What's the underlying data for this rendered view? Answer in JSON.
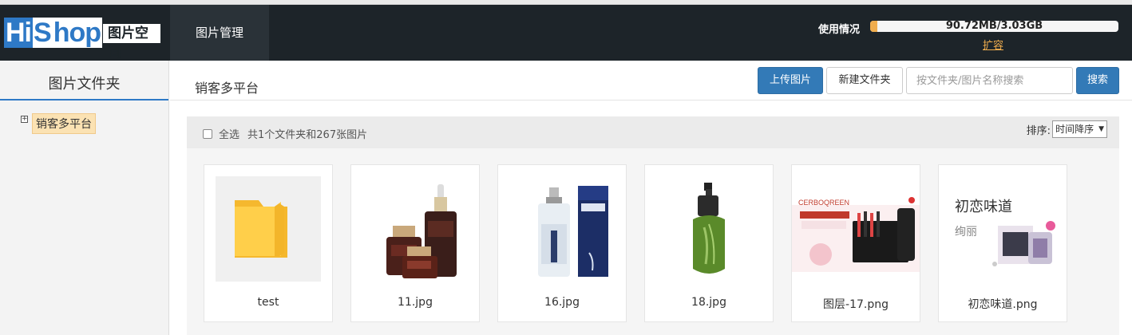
{
  "header": {
    "logo": {
      "brand_part1": "Hi",
      "brand_part2": "S",
      "brand_part3": "hop",
      "subtitle": "图片空间"
    },
    "nav_tab": "图片管理",
    "usage_label": "使用情况",
    "usage_text": "90.72MB/3.03GB",
    "usage_fraction": 0.029,
    "expand_link": "扩容"
  },
  "sidebar": {
    "title": "图片文件夹",
    "tree": [
      {
        "toggle": "+",
        "label": "销客多平台"
      }
    ]
  },
  "main": {
    "title": "销客多平台",
    "upload_label": "上传图片",
    "new_folder_label": "新建文件夹",
    "search_placeholder": "按文件夹/图片名称搜索",
    "search_value": "",
    "search_label": "搜索"
  },
  "toolbar": {
    "select_all_label": "全选",
    "summary": "共1个文件夹和267张图片",
    "sort_label": "排序:",
    "sort_value": "时间降序"
  },
  "items": [
    {
      "name": "test",
      "type": "folder",
      "icon": "folder-icon"
    },
    {
      "name": "11.jpg",
      "type": "image"
    },
    {
      "name": "16.jpg",
      "type": "image"
    },
    {
      "name": "18.jpg",
      "type": "image"
    },
    {
      "name": "图层-17.png",
      "type": "image"
    },
    {
      "name": "初恋味道.png",
      "type": "image"
    }
  ],
  "colors": {
    "header_bg": "#1d2429",
    "primary": "#337ab7",
    "usage_fill": "#f0ad4e",
    "folder": "#ffc83d"
  }
}
